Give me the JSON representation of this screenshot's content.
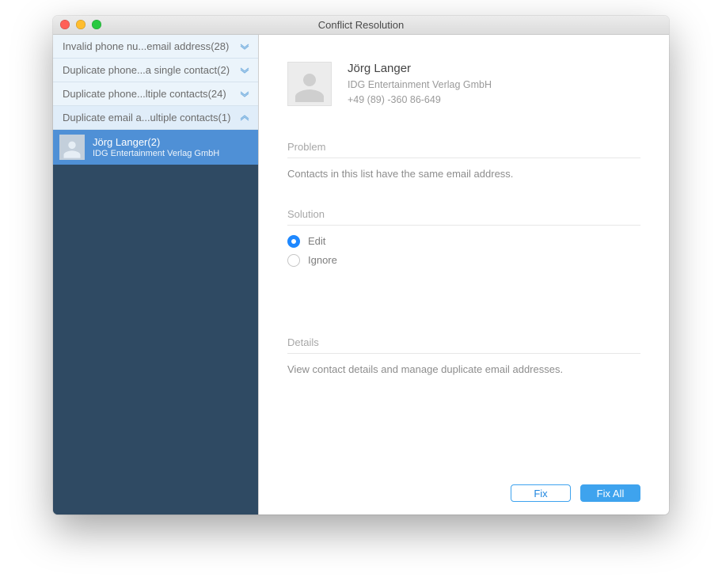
{
  "window": {
    "title": "Conflict Resolution"
  },
  "sidebar": {
    "categories": [
      {
        "label": "Invalid phone nu...email address",
        "count": "(28)",
        "expanded": false
      },
      {
        "label": "Duplicate phone...a single contact",
        "count": "(2)",
        "expanded": false
      },
      {
        "label": "Duplicate phone...ltiple contacts",
        "count": "(24)",
        "expanded": false
      },
      {
        "label": "Duplicate email a...ultiple contacts",
        "count": "(1)",
        "expanded": true
      }
    ],
    "selected_contact": {
      "name": "Jörg Langer",
      "count": "(2)",
      "org": "IDG Entertainment Verlag GmbH"
    }
  },
  "contact_header": {
    "name": "Jörg Langer",
    "org": "IDG Entertainment Verlag GmbH",
    "phone": "+49 (89) -360 86-649"
  },
  "problem": {
    "label": "Problem",
    "text": "Contacts in this list have the same email address."
  },
  "solution": {
    "label": "Solution",
    "options": [
      {
        "label": "Edit",
        "selected": true
      },
      {
        "label": "Ignore",
        "selected": false
      }
    ]
  },
  "details": {
    "label": "Details",
    "text": "View contact details and manage duplicate email addresses."
  },
  "buttons": {
    "fix": "Fix",
    "fix_all": "Fix All"
  }
}
